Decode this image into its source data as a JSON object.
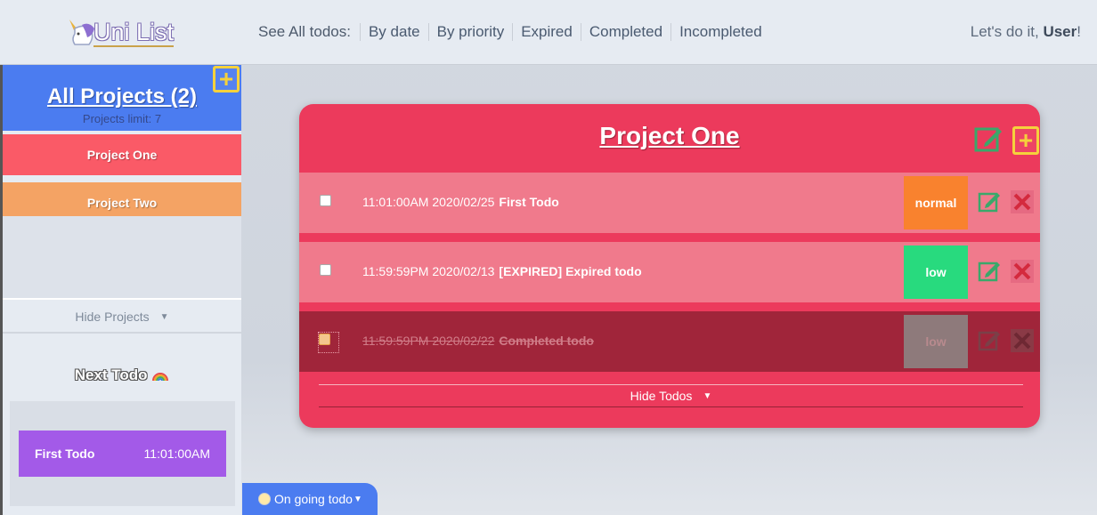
{
  "brand": {
    "name": "Uni List"
  },
  "nav": {
    "lead": "See All todos:",
    "links": [
      "By date",
      "By priority",
      "Expired",
      "Completed",
      "Incompleted"
    ]
  },
  "greeting": {
    "prefix": "Let's do it, ",
    "user": "User",
    "suffix": "!"
  },
  "sidebar": {
    "header_title": "All Projects (2)",
    "limit_text": "Projects limit: 7",
    "projects": [
      {
        "name": "Project One",
        "color": "#fa5a67"
      },
      {
        "name": "Project Two",
        "color": "#f4a364"
      }
    ],
    "hide_label": "Hide Projects",
    "next_title": "Next Todo",
    "next_todo": {
      "name": "First Todo",
      "time": "11:01:00AM"
    }
  },
  "project": {
    "title": "Project One",
    "todos": [
      {
        "when": "11:01:00AM 2020/02/25",
        "name": "First Todo",
        "priority": "normal",
        "priority_color": "#f9822e",
        "checked": false
      },
      {
        "when": "11:59:59PM 2020/02/13",
        "name": "[EXPIRED] Expired todo",
        "priority": "low",
        "priority_color": "#28da7e",
        "checked": false
      },
      {
        "when": "11:59:59PM 2020/02/22",
        "name": "Completed todo",
        "priority": "low",
        "priority_color": "#8e7a7b",
        "checked": true
      }
    ],
    "hide_label": "Hide Todos"
  },
  "ongoing": {
    "label": "On going todo"
  },
  "colors": {
    "accent_blue": "#4b7cf0",
    "card_red": "#ec3a5c",
    "todo_pink": "#f07a8c",
    "done_dark": "#a0253a",
    "plus_yellow": "#f5d13c",
    "edit_green": "#3aa86a"
  }
}
